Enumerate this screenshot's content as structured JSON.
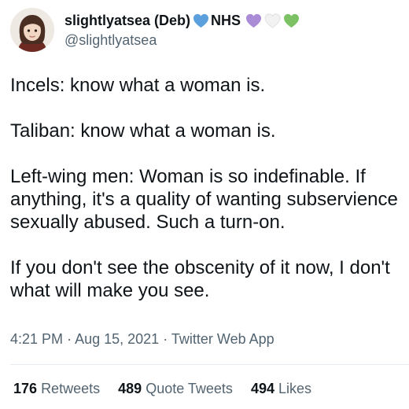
{
  "author": {
    "display_name": "slightlyatsea (Deb)",
    "name_suffix": "NHS",
    "handle": "@slightlyatsea",
    "heart_colors": {
      "blue": "#5b9fdd",
      "purple": "#a98bd6",
      "white": "#f2f2f2",
      "green": "#7cc265"
    }
  },
  "tweet": {
    "paragraphs": [
      [
        "Incels: know what a woman is."
      ],
      [
        "Taliban: know what a woman is."
      ],
      [
        "Left-wing men: Woman is so indefinable. If",
        "anything, it's a quality of wanting subservience",
        "sexually abused. Such a turn-on."
      ],
      [
        "If you don't see the obscenity of it now, I don't",
        "what will make you see."
      ]
    ],
    "time": "4:21 PM",
    "date": "Aug 15, 2021",
    "source": "Twitter Web App",
    "separator": "·"
  },
  "stats": {
    "retweets": {
      "count": "176",
      "label": "Retweets"
    },
    "quote_tweets": {
      "count": "489",
      "label": "Quote Tweets"
    },
    "likes": {
      "count": "494",
      "label": "Likes"
    }
  }
}
